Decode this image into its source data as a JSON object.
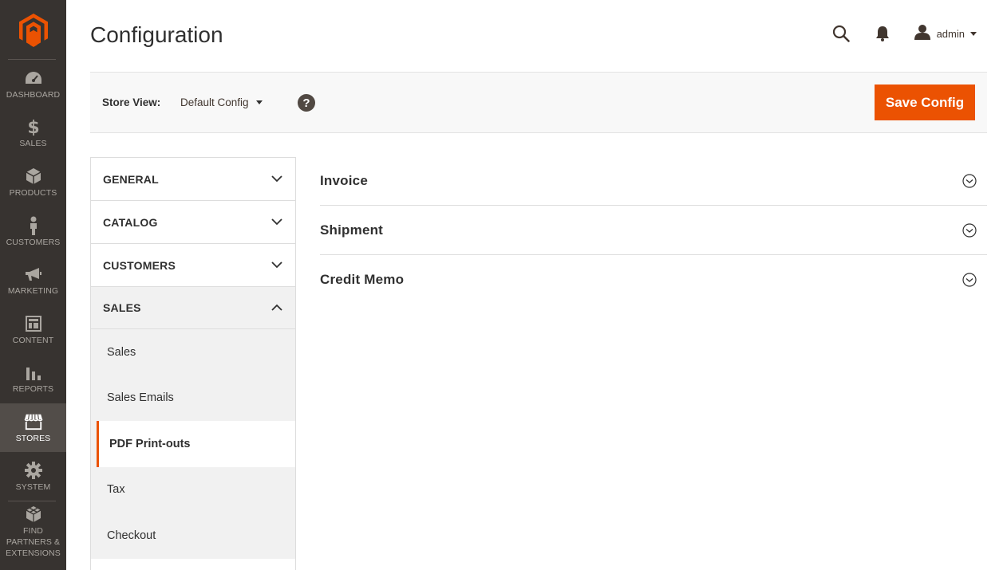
{
  "menu": {
    "items": [
      {
        "label": "DASHBOARD",
        "icon": "dashboard-icon"
      },
      {
        "label": "SALES",
        "icon": "dollar-icon"
      },
      {
        "label": "PRODUCTS",
        "icon": "box-icon"
      },
      {
        "label": "CUSTOMERS",
        "icon": "person-icon"
      },
      {
        "label": "MARKETING",
        "icon": "megaphone-icon"
      },
      {
        "label": "CONTENT",
        "icon": "layout-icon"
      },
      {
        "label": "REPORTS",
        "icon": "bar-chart-icon"
      },
      {
        "label": "STORES",
        "icon": "storefront-icon"
      },
      {
        "label": "SYSTEM",
        "icon": "gear-icon"
      },
      {
        "label": "FIND PARTNERS & EXTENSIONS",
        "icon": "extensions-icon"
      }
    ],
    "active": "STORES"
  },
  "header": {
    "title": "Configuration",
    "user": "admin"
  },
  "scope": {
    "label": "Store View:",
    "value": "Default Config",
    "save_label": "Save Config"
  },
  "tabs": {
    "general": "GENERAL",
    "catalog": "CATALOG",
    "customers": "CUSTOMERS",
    "sales": "SALES",
    "sales_items": [
      "Sales",
      "Sales Emails",
      "PDF Print-outs",
      "Tax",
      "Checkout"
    ],
    "active_item": "PDF Print-outs"
  },
  "sections": [
    "Invoice",
    "Shipment",
    "Credit Memo"
  ],
  "colors": {
    "accent": "#eb5202",
    "menu_bg": "#373330",
    "menu_active": "#524d49"
  }
}
